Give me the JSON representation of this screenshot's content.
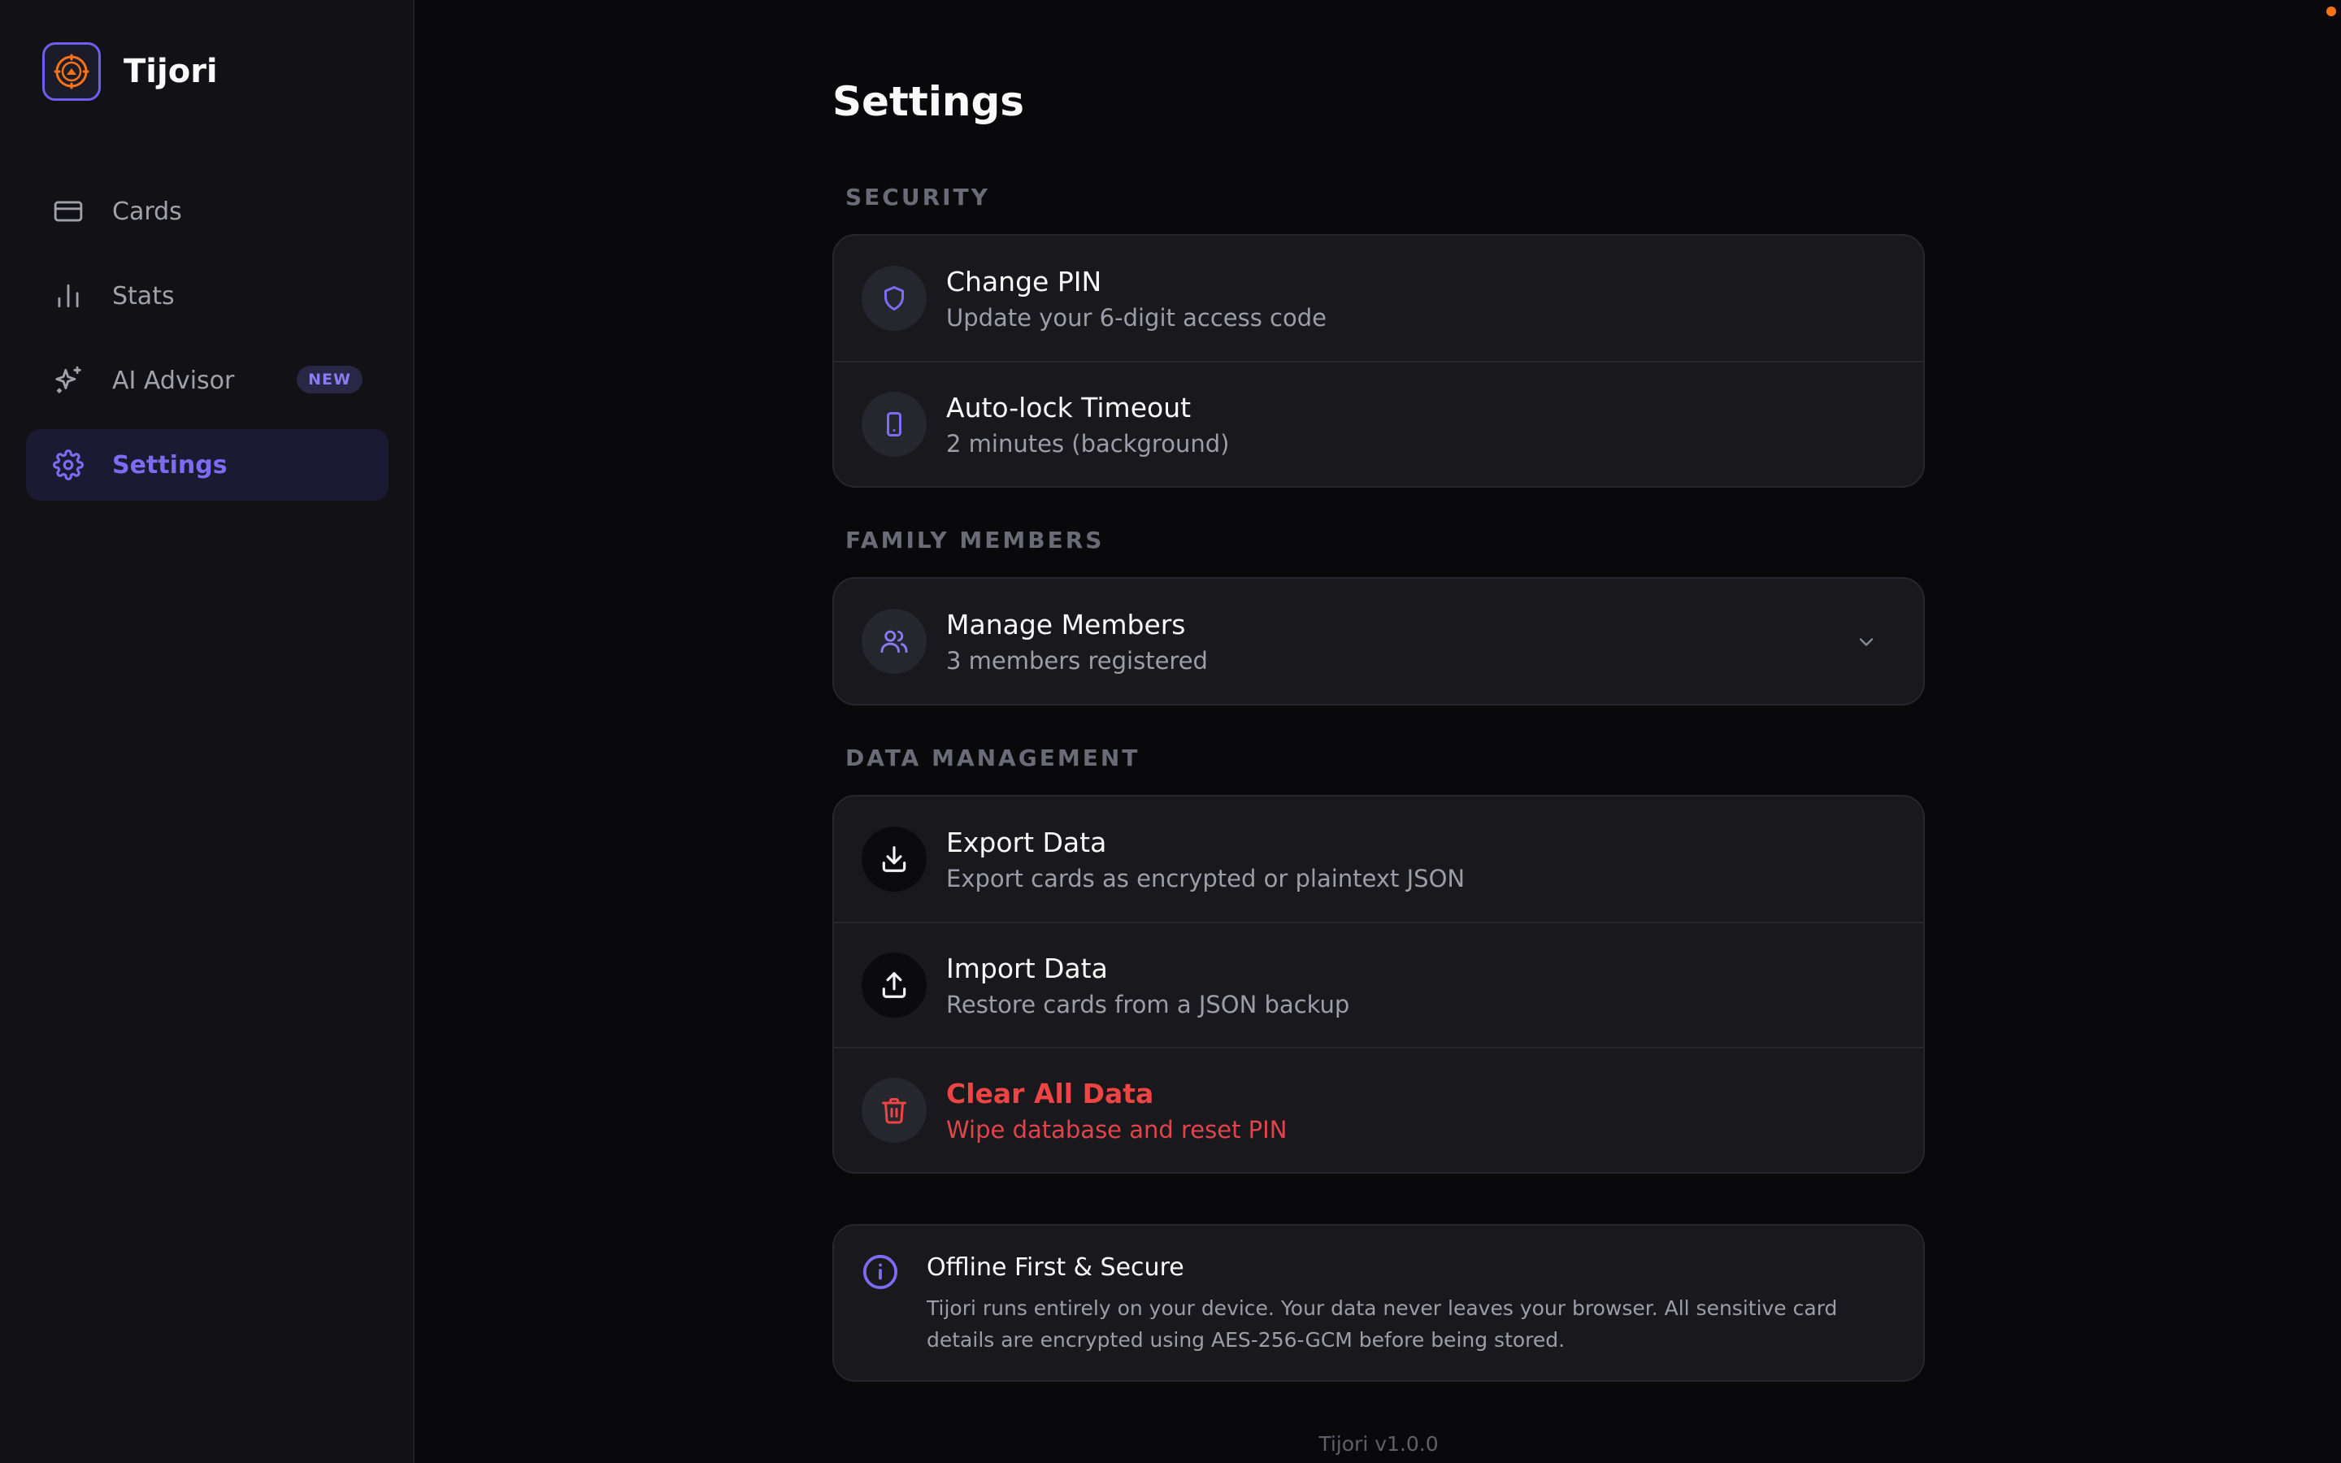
{
  "brand": {
    "name": "Tijori",
    "logo_icon": "vault-dial-icon"
  },
  "sidebar": {
    "items": [
      {
        "label": "Cards",
        "icon": "credit-card-icon"
      },
      {
        "label": "Stats",
        "icon": "bar-chart-icon"
      },
      {
        "label": "AI Advisor",
        "icon": "sparkles-icon",
        "badge": "NEW"
      },
      {
        "label": "Settings",
        "icon": "gear-icon",
        "active": true
      }
    ]
  },
  "page": {
    "title": "Settings"
  },
  "sections": {
    "security": {
      "label": "SECURITY",
      "change_pin": {
        "title": "Change PIN",
        "subtitle": "Update your 6-digit access code",
        "icon": "shield-icon"
      },
      "auto_lock": {
        "title": "Auto-lock Timeout",
        "subtitle": "2 minutes (background)",
        "icon": "phone-icon"
      }
    },
    "family": {
      "label": "FAMILY MEMBERS",
      "manage": {
        "title": "Manage Members",
        "subtitle": "3 members registered",
        "icon": "users-icon"
      }
    },
    "data": {
      "label": "DATA MANAGEMENT",
      "export": {
        "title": "Export Data",
        "subtitle": "Export cards as encrypted or plaintext JSON",
        "icon": "download-icon"
      },
      "import": {
        "title": "Import Data",
        "subtitle": "Restore cards from a JSON backup",
        "icon": "upload-icon"
      },
      "clear": {
        "title": "Clear All Data",
        "subtitle": "Wipe database and reset PIN",
        "icon": "trash-icon"
      }
    }
  },
  "info": {
    "title": "Offline First & Secure",
    "body": "Tijori runs entirely on your device. Your data never leaves your browser. All sensitive card details are encrypted using AES-256-GCM before being stored.",
    "icon": "info-icon"
  },
  "footer": {
    "version": "Tijori v1.0.0"
  },
  "colors": {
    "accent": "#7c6cf2",
    "danger": "#ef4444",
    "background": "#09090b",
    "sidebar": "#111116",
    "card": "#18181d",
    "logo_orange": "#f97316"
  }
}
